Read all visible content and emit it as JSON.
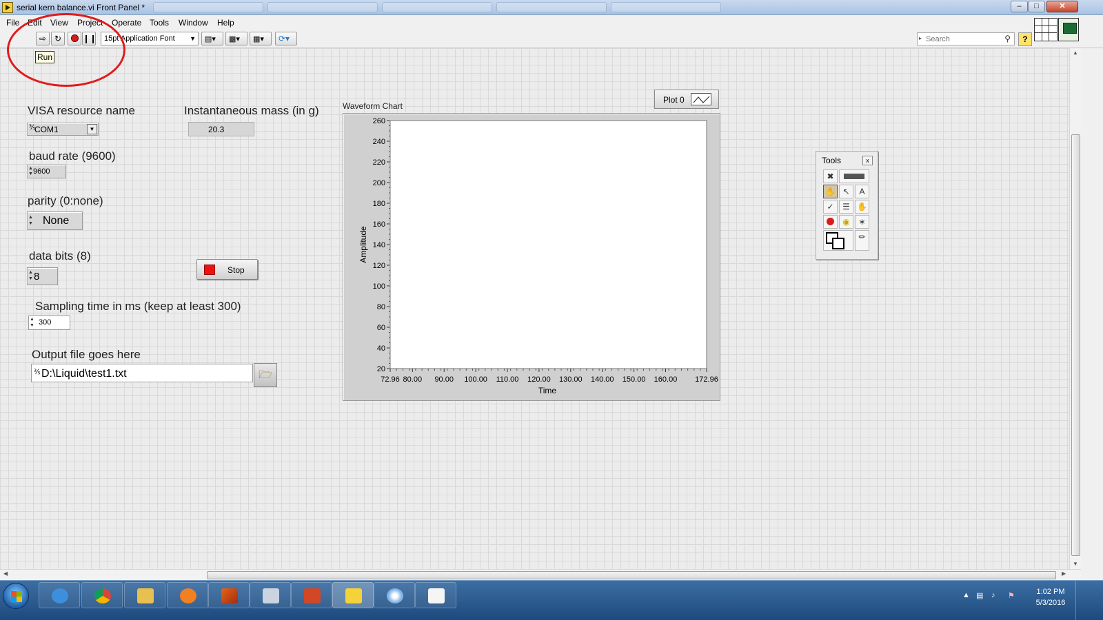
{
  "window": {
    "title": "serial kern balance.vi Front Panel *"
  },
  "menu": [
    "File",
    "Edit",
    "View",
    "Project",
    "Operate",
    "Tools",
    "Window",
    "Help"
  ],
  "toolbar": {
    "font": "15pt Application Font",
    "search_placeholder": "Search",
    "help_label": "?",
    "run_tooltip": "Run"
  },
  "controls": {
    "visa": {
      "label": "VISA resource name",
      "value": "COM1"
    },
    "mass": {
      "label": "Instantaneous mass (in g)",
      "value": "20.3"
    },
    "baud": {
      "label": "baud rate (9600)",
      "value": "9600"
    },
    "parity": {
      "label": "parity (0:none)",
      "value": "None"
    },
    "databits": {
      "label": "data bits (8)",
      "value": "8"
    },
    "stop": {
      "label": "Stop"
    },
    "sampling": {
      "label": "Sampling time in ms (keep at least 300)",
      "value": "300"
    },
    "output": {
      "label": "Output file goes here",
      "value": "D:\\Liquid\\test1.txt"
    }
  },
  "chart_data": {
    "type": "line",
    "title": "Waveform Chart",
    "legend": "Plot 0",
    "xlabel": "Time",
    "ylabel": "Amplitude",
    "xlim": [
      72.96,
      172.96
    ],
    "ylim": [
      20,
      260
    ],
    "x_ticks": [
      "72.96",
      "80.00",
      "90.00",
      "100.00",
      "110.00",
      "120.00",
      "130.00",
      "140.00",
      "150.00",
      "160.00",
      "172.96"
    ],
    "y_ticks": [
      "260",
      "240",
      "220",
      "200",
      "180",
      "160",
      "140",
      "120",
      "100",
      "80",
      "60",
      "40",
      "20"
    ],
    "series": [
      {
        "name": "Plot 0",
        "values": []
      }
    ],
    "grid": false
  },
  "tools_palette": {
    "title": "Tools",
    "close_label": "x"
  },
  "taskbar": {
    "time": "1:02 PM",
    "date": "5/3/2016"
  },
  "colors": {
    "stop_red": "#ee1111",
    "annotation_red": "#e01b1b",
    "taskbar_blue": "#2a5a90"
  }
}
